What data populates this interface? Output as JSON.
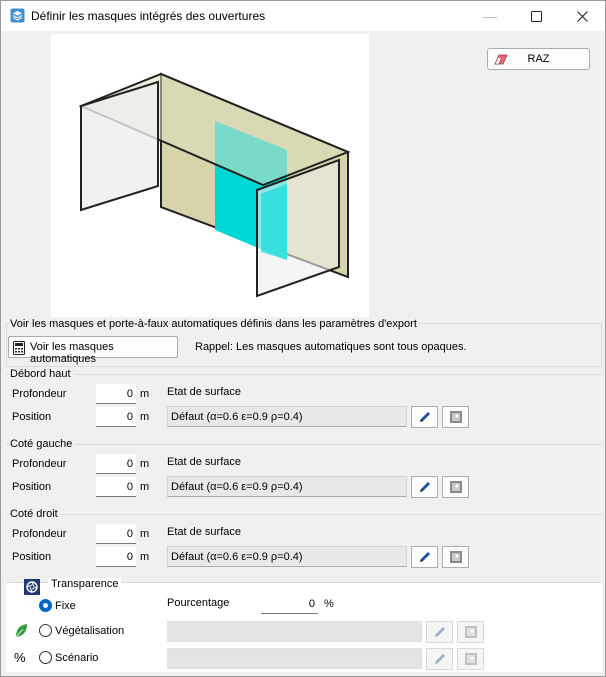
{
  "window": {
    "title": "Définir les masques intégrés des ouvertures",
    "min_symbol": "—",
    "max_symbol": "☐",
    "close_symbol": "✕"
  },
  "raz_button": {
    "label": "RAZ"
  },
  "auto_masks": {
    "group_title": "Voir les masques et porte-à-faux automatiques définis dans les paramètres d'export",
    "button_label": "Voir les masques automatiques",
    "reminder": "Rappel: Les masques automatiques sont tous opaques."
  },
  "sections": [
    {
      "title": "Débord haut",
      "depth_label": "Profondeur",
      "depth_value": "0",
      "depth_unit": "m",
      "position_label": "Position",
      "position_value": "0",
      "position_unit": "m",
      "surface_label": "Etat de surface",
      "surface_value": "Défaut (α=0.6 ε=0.9 ρ=0.4)"
    },
    {
      "title": "Coté gauche",
      "depth_label": "Profondeur",
      "depth_value": "0",
      "depth_unit": "m",
      "position_label": "Position",
      "position_value": "0",
      "position_unit": "m",
      "surface_label": "Etat de surface",
      "surface_value": "Défaut (α=0.6 ε=0.9 ρ=0.4)"
    },
    {
      "title": "Coté droit",
      "depth_label": "Profondeur",
      "depth_value": "0",
      "depth_unit": "m",
      "position_label": "Position",
      "position_value": "0",
      "position_unit": "m",
      "surface_label": "Etat de surface",
      "surface_value": "Défaut (α=0.6 ε=0.9 ρ=0.4)"
    }
  ],
  "transparence": {
    "title": "Transparence",
    "options": [
      {
        "label": "Fixe",
        "selected": true
      },
      {
        "label": "Végétalisation",
        "selected": false
      },
      {
        "label": "Scénario",
        "selected": false
      }
    ],
    "percent_label": "Pourcentage",
    "percent_value": "0",
    "percent_unit": "%",
    "scenario_icon_text": "%"
  },
  "colors": {
    "accent": "#0067c0",
    "glass": "#00d6d6",
    "mask_fill": "#d8d6b0",
    "pencil": "#1a4f9c",
    "leaf": "#2e9e3a"
  }
}
